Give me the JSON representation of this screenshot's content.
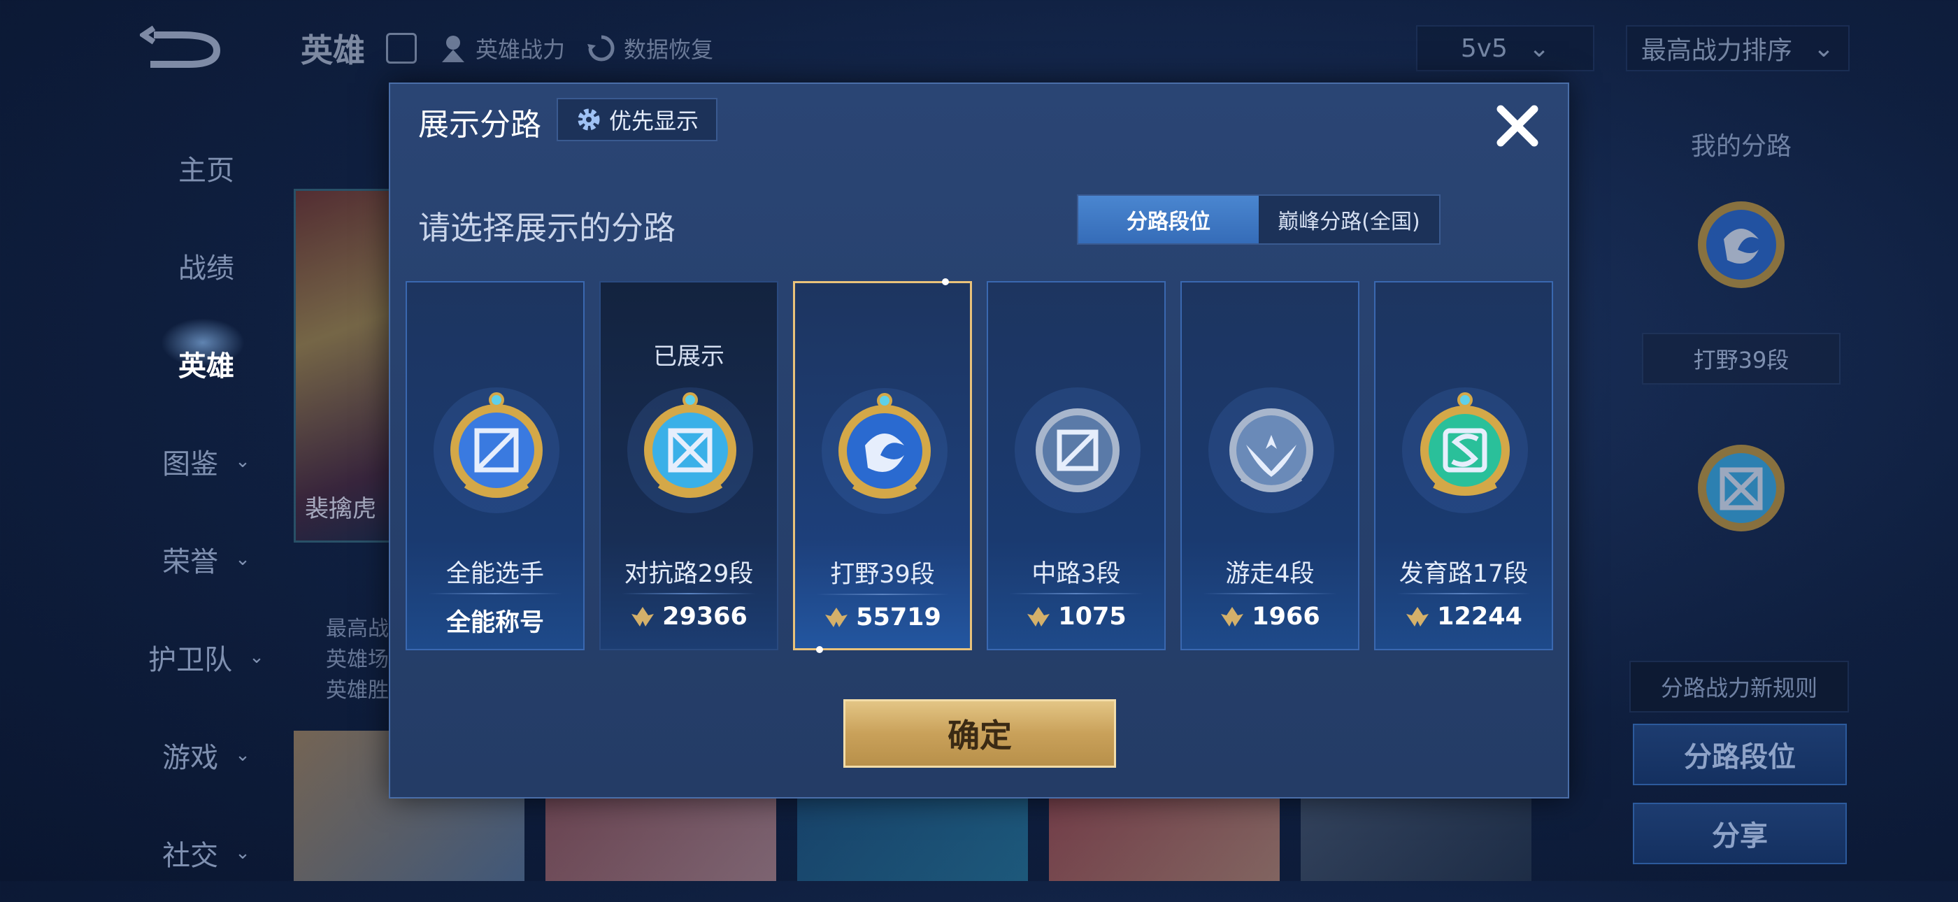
{
  "header": {
    "title": "英雄",
    "items": [
      "英雄战力",
      "数据恢复"
    ],
    "mode_select": "5v5",
    "sort_select": "最高战力排序"
  },
  "sidebar": {
    "items": [
      {
        "label": "主页",
        "has_chevron": false
      },
      {
        "label": "战绩",
        "has_chevron": false
      },
      {
        "label": "英雄",
        "has_chevron": false,
        "active": true
      },
      {
        "label": "图鉴",
        "has_chevron": true
      },
      {
        "label": "荣誉",
        "has_chevron": true
      },
      {
        "label": "护卫队",
        "has_chevron": true
      },
      {
        "label": "游戏",
        "has_chevron": true
      },
      {
        "label": "社交",
        "has_chevron": true
      }
    ]
  },
  "hero": {
    "name": "裴擒虎",
    "stats": [
      "最高战",
      "英雄场",
      "英雄胜"
    ]
  },
  "right_panel": {
    "title": "我的分路",
    "current_label": "打野39段",
    "rule_label": "分路战力新规则",
    "btn_rank": "分路段位",
    "btn_share": "分享"
  },
  "modal": {
    "title": "展示分路",
    "priority_label": "优先显示",
    "subtitle": "请选择展示的分路",
    "tabs": [
      {
        "label": "分路段位",
        "active": true
      },
      {
        "label": "巅峰分路(全国)",
        "active": false
      }
    ],
    "cards": [
      {
        "name": "全能选手",
        "value": "全能称号",
        "show_icon": false,
        "shown_label": "",
        "icon": "all-round-badge-icon",
        "color": "#3a7ae0"
      },
      {
        "name": "对抗路29段",
        "value": "29366",
        "show_icon": true,
        "shown_label": "已展示",
        "icon": "clash-lane-badge-icon",
        "color": "#3ab0e8"
      },
      {
        "name": "打野39段",
        "value": "55719",
        "show_icon": true,
        "shown_label": "",
        "icon": "jungle-badge-icon",
        "color": "#2a6ad0",
        "selected": true
      },
      {
        "name": "中路3段",
        "value": "1075",
        "show_icon": true,
        "shown_label": "",
        "icon": "mid-lane-badge-icon",
        "color": "#5a7aa8"
      },
      {
        "name": "游走4段",
        "value": "1966",
        "show_icon": true,
        "shown_label": "",
        "icon": "roam-badge-icon",
        "color": "#6a8ab8"
      },
      {
        "name": "发育路17段",
        "value": "12244",
        "show_icon": true,
        "shown_label": "",
        "icon": "farm-lane-badge-icon",
        "color": "#2ac09a"
      }
    ],
    "confirm_label": "确定"
  }
}
